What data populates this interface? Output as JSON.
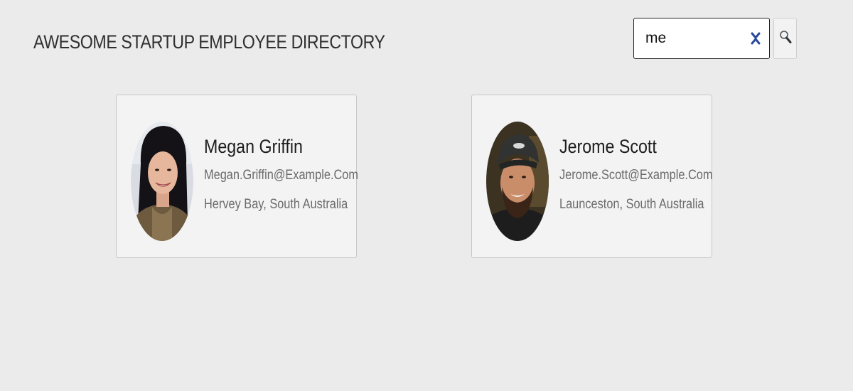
{
  "header": {
    "title": "AWESOME STARTUP EMPLOYEE DIRECTORY"
  },
  "search": {
    "value": "me",
    "clear_icon": "close-icon",
    "search_icon": "search-icon",
    "clear_color": "#2a4a9a"
  },
  "employees": [
    {
      "name": "Megan Griffin",
      "email": "Megan.Griffin@Example.Com",
      "location": "Hervey Bay, South Australia",
      "avatar": "avatar-photo"
    },
    {
      "name": "Jerome Scott",
      "email": "Jerome.Scott@Example.Com",
      "location": "Launceston, South Australia",
      "avatar": "avatar-photo"
    }
  ]
}
